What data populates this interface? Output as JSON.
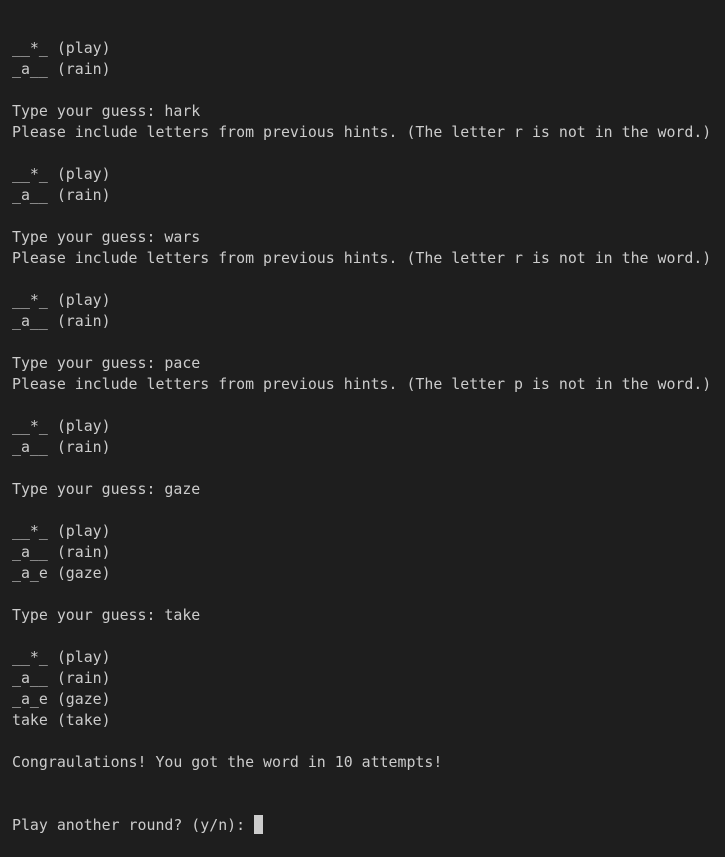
{
  "colors": {
    "background": "#1e1e1e",
    "text": "#cccccc",
    "cursor": "#cccccc"
  },
  "lines": [
    "__*_ (play)",
    "_a__ (rain)",
    "",
    "Type your guess: hark",
    "Please include letters from previous hints. (The letter r is not in the word.)",
    "",
    "__*_ (play)",
    "_a__ (rain)",
    "",
    "Type your guess: wars",
    "Please include letters from previous hints. (The letter r is not in the word.)",
    "",
    "__*_ (play)",
    "_a__ (rain)",
    "",
    "Type your guess: pace",
    "Please include letters from previous hints. (The letter p is not in the word.)",
    "",
    "__*_ (play)",
    "_a__ (rain)",
    "",
    "Type your guess: gaze",
    "",
    "__*_ (play)",
    "_a__ (rain)",
    "_a_e (gaze)",
    "",
    "Type your guess: take",
    "",
    "__*_ (play)",
    "_a__ (rain)",
    "_a_e (gaze)",
    "take (take)",
    "",
    "Congraulations! You got the word in 10 attempts!"
  ],
  "prompt": "Play another round? (y/n): "
}
